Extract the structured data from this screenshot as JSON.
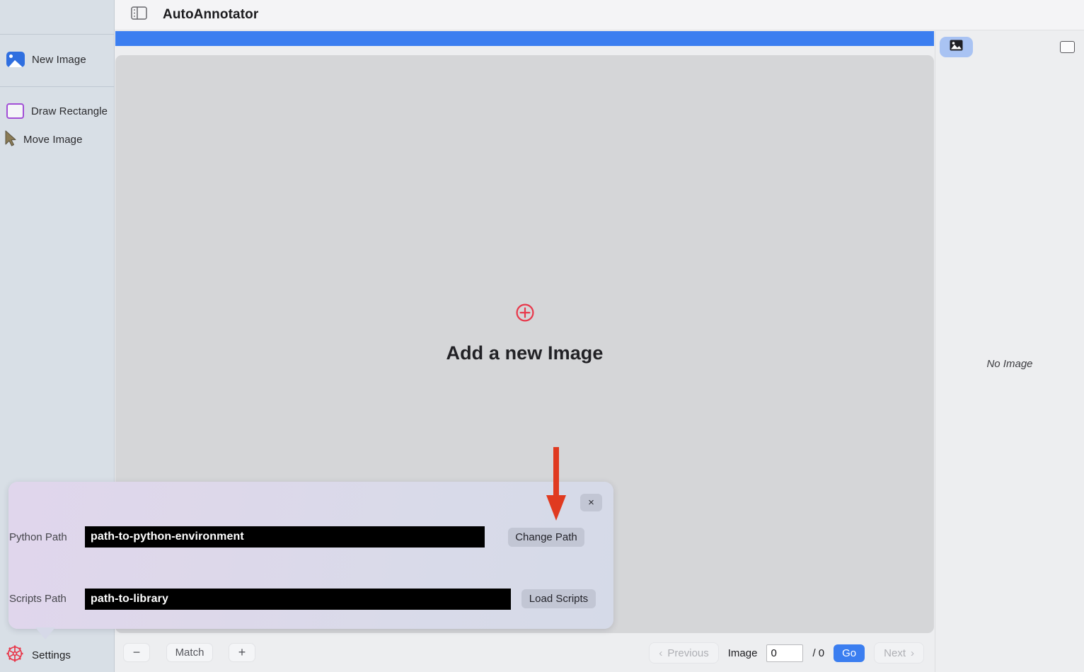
{
  "header": {
    "title": "AutoAnnotator",
    "panel_toggle_icon": "sidebar-toggle-icon"
  },
  "sidebar": {
    "items": [
      {
        "label": "New Image",
        "icon": "image-icon"
      },
      {
        "label": "Draw Rectangle",
        "icon": "rectangle-icon"
      },
      {
        "label": "Move Image",
        "icon": "cursor-arrow-icon"
      }
    ],
    "settings": {
      "label": "Settings",
      "icon": "gear-icon",
      "icon_color": "#e8374a"
    }
  },
  "canvas": {
    "empty_state": {
      "icon": "plus-circle-icon",
      "icon_color": "#e8374a",
      "label": "Add a new Image"
    },
    "background_color": "#d5d6d8"
  },
  "progress_bar": {
    "color": "#3b7ef0",
    "value_percent": 100
  },
  "right_panel": {
    "thumbnail_button_icon": "image-thumbnail-icon",
    "thumbnail_button_color": "#a9c3f3",
    "select_all_checkbox": "",
    "empty_text": "No Image"
  },
  "bottom_bar": {
    "zoom_out_label": "−",
    "match_label": "Match",
    "zoom_in_label": "+",
    "previous_label": "Previous",
    "next_label": "Next",
    "image_label": "Image",
    "image_index_value": "0",
    "image_total": "/ 0",
    "go_label": "Go",
    "go_color": "#3b7ef0"
  },
  "settings_popover": {
    "close_label": "×",
    "python_path_label": "Python Path",
    "python_path_value": "path-to-python-environment",
    "change_path_label": "Change Path",
    "scripts_path_label": "Scripts Path",
    "scripts_path_value": "path-to-library",
    "load_scripts_label": "Load Scripts"
  },
  "annotation": {
    "arrow_color": "#e03a20",
    "arrow_points_to": "Change Path"
  }
}
